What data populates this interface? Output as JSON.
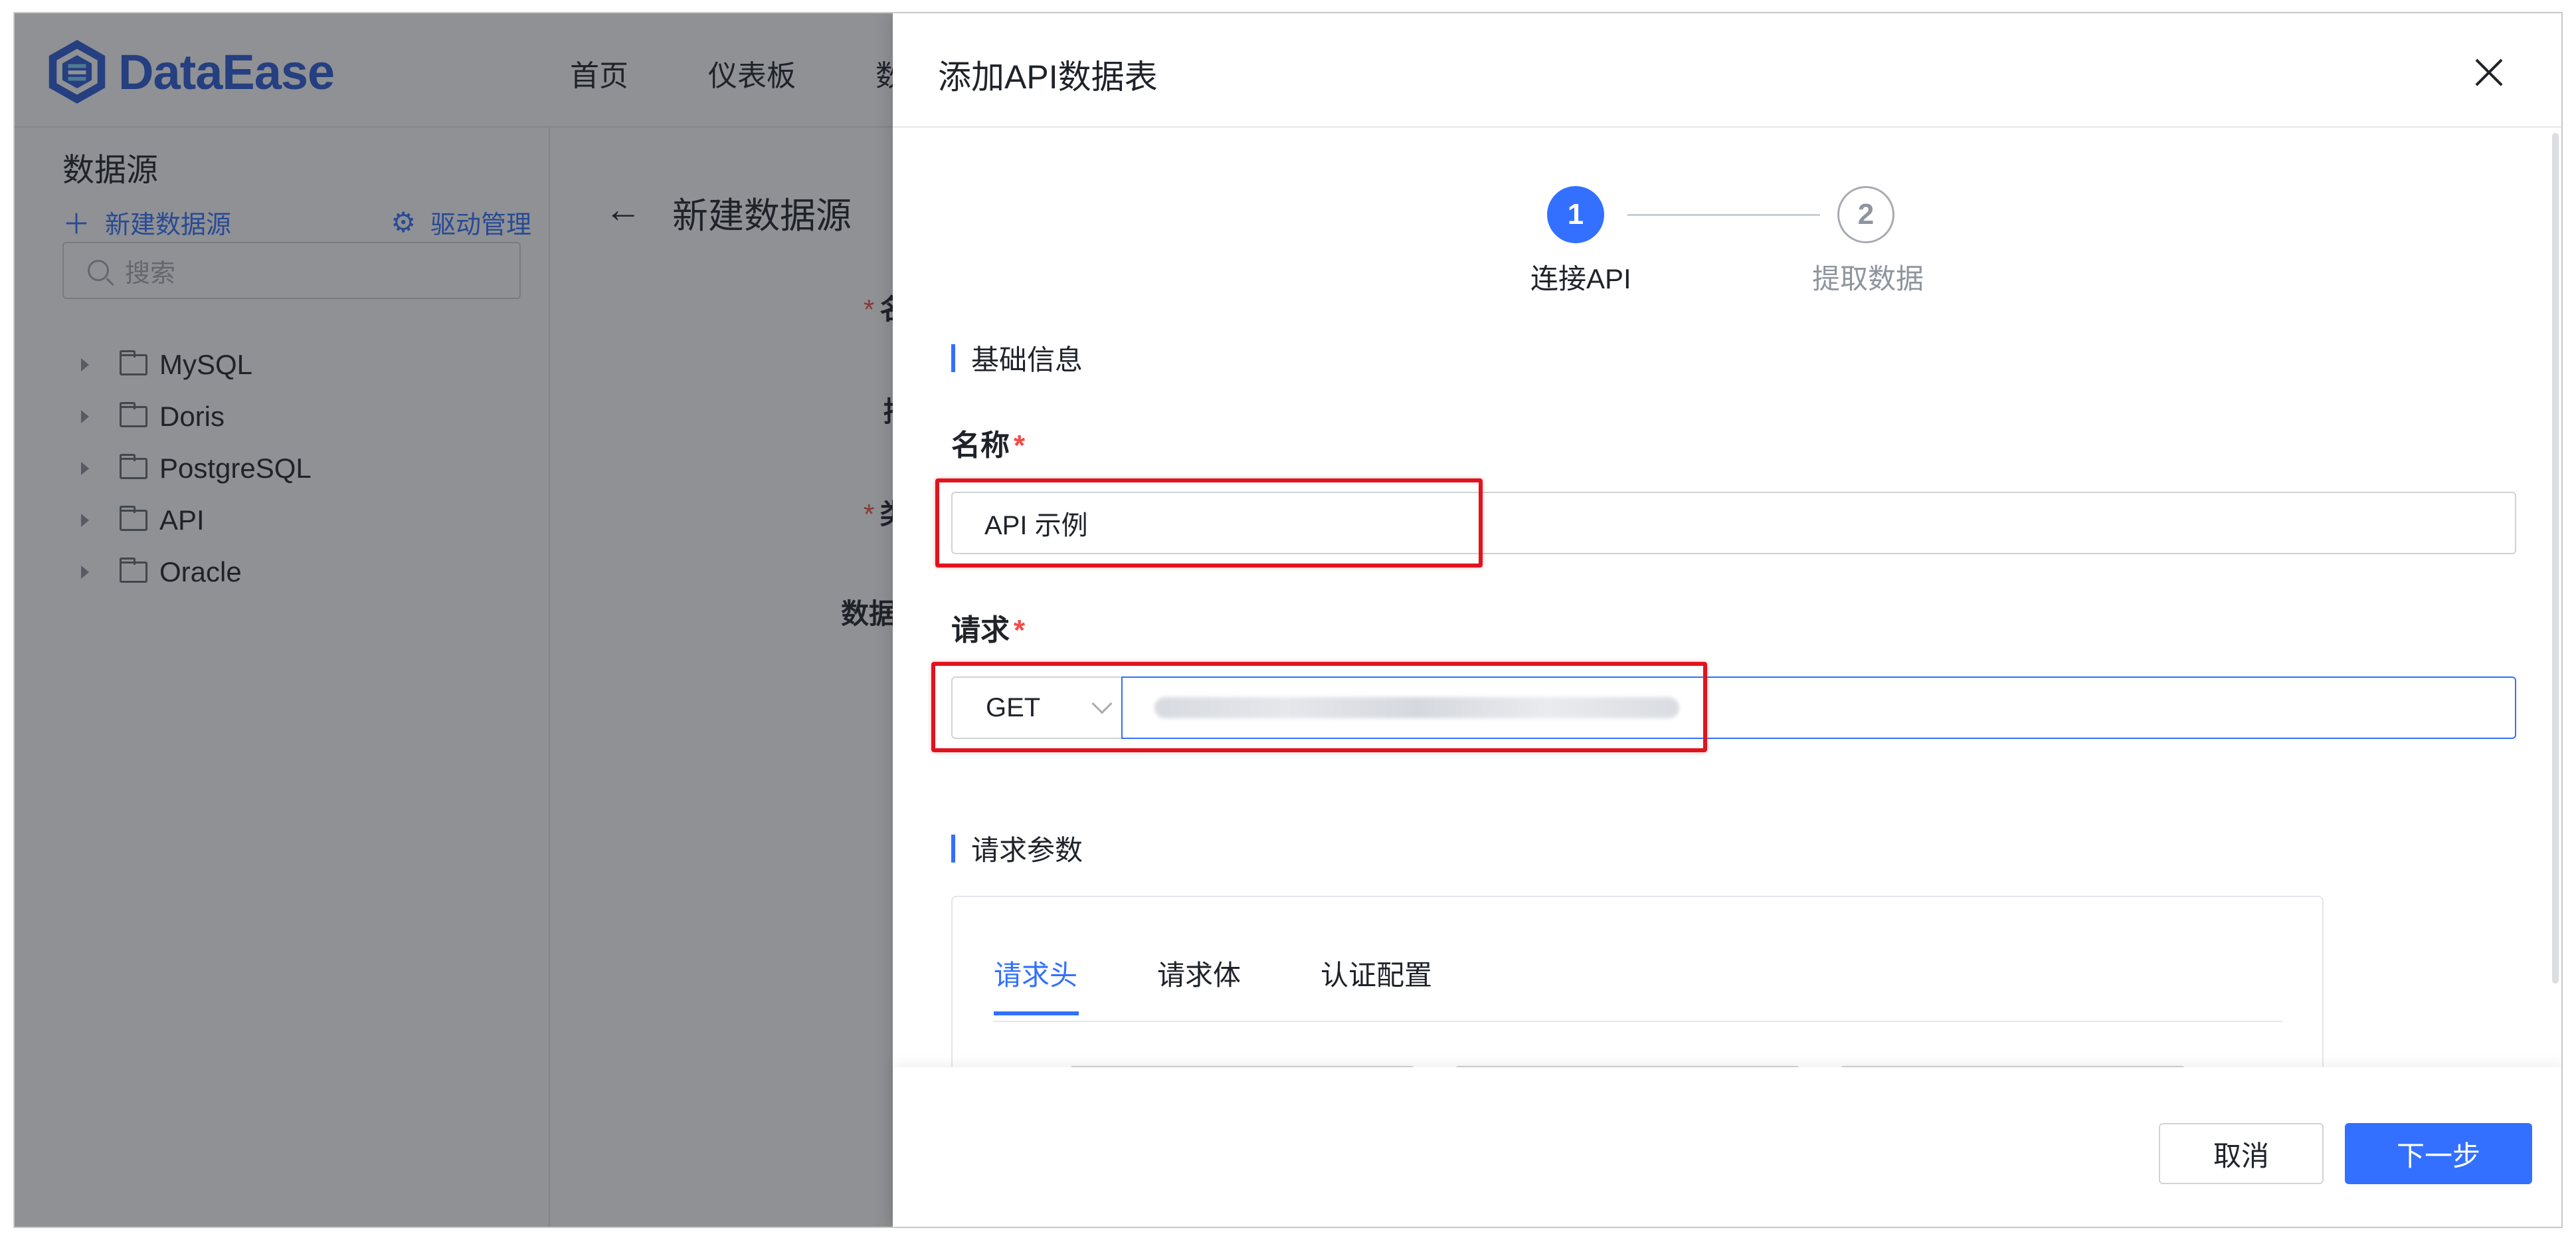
{
  "app": {
    "logo_text": "DataEase",
    "nav": [
      "首页",
      "仪表板",
      "数"
    ]
  },
  "sidebar": {
    "title": "数据源",
    "new_datasource": "新建数据源",
    "driver_manage": "驱动管理",
    "search_placeholder": "搜索",
    "tree": [
      "MySQL",
      "Doris",
      "PostgreSQL",
      "API",
      "Oracle"
    ]
  },
  "main": {
    "back_arrow": "←",
    "title": "新建数据源",
    "form_fragments": [
      "名",
      "描",
      "类",
      "数据"
    ]
  },
  "drawer": {
    "title": "添加API数据表",
    "steps": [
      {
        "num": "1",
        "label": "连接API"
      },
      {
        "num": "2",
        "label": "提取数据"
      }
    ],
    "basic_info": "基础信息",
    "name_label": "名称",
    "required_mark": "*",
    "name_value": "API 示例",
    "request_label": "请求",
    "method": "GET",
    "request_params": "请求参数",
    "tabs": [
      "请求头",
      "请求体",
      "认证配置"
    ],
    "cancel": "取消",
    "next": "下一步"
  },
  "colors": {
    "primary": "#3370ff",
    "highlight": "#e0141e",
    "logo": "#2b5bd7"
  }
}
